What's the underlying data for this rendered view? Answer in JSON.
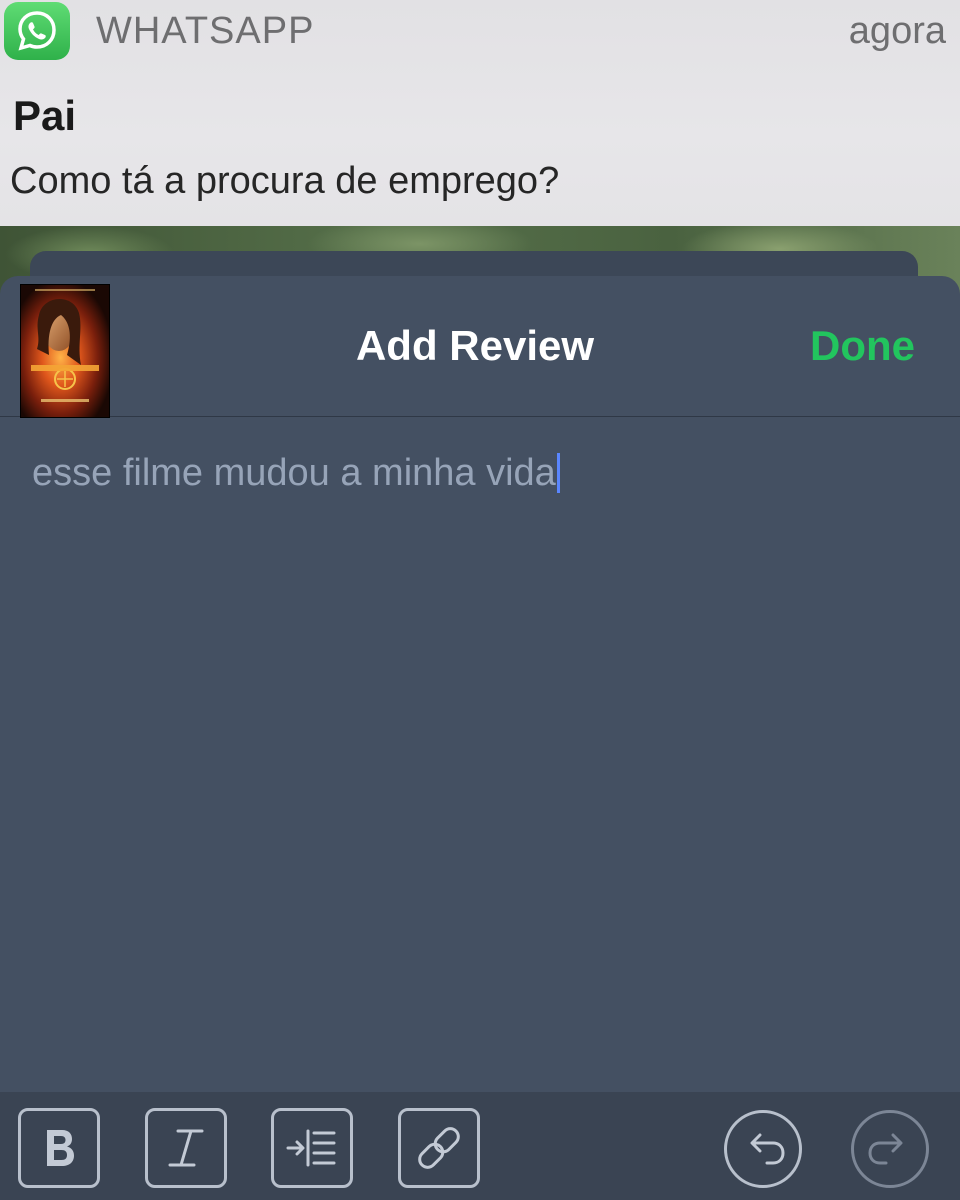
{
  "notification": {
    "app_icon": "whatsapp-icon",
    "app_name": "WHATSAPP",
    "time": "agora",
    "sender": "Pai",
    "message": "Como tá a procura de emprego?"
  },
  "sheet": {
    "title": "Add Review",
    "done_label": "Done",
    "poster_icon": "movie-poster-thumbnail",
    "review_text": "esse filme mudou a minha vida"
  },
  "toolbar": {
    "buttons": [
      {
        "icon": "bold-icon"
      },
      {
        "icon": "italic-icon"
      },
      {
        "icon": "indent-icon"
      },
      {
        "icon": "link-icon"
      },
      {
        "icon": "undo-icon"
      },
      {
        "icon": "redo-icon"
      }
    ]
  },
  "colors": {
    "done": "#22c55e",
    "sheet_background": "#445062",
    "toolbar_background": "#3a4453",
    "placeholder_text": "#97a4b8"
  }
}
